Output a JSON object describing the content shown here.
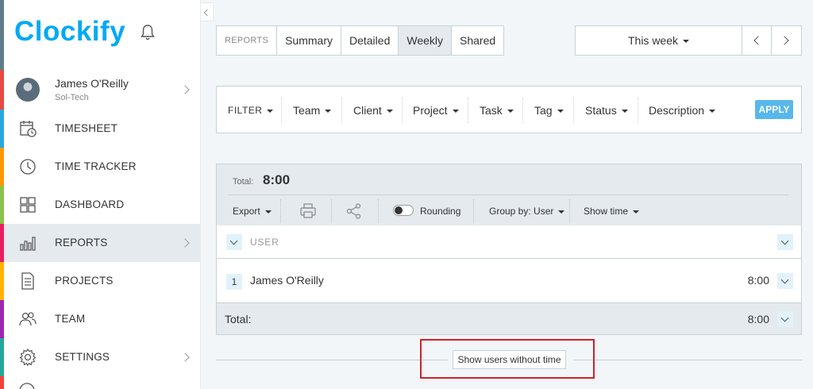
{
  "app": {
    "logo_text": "Clockify"
  },
  "user": {
    "name": "James O'Reilly",
    "workspace": "Sol-Tech"
  },
  "sidebar": {
    "items": [
      {
        "label": "TIMESHEET"
      },
      {
        "label": "TIME TRACKER"
      },
      {
        "label": "DASHBOARD"
      },
      {
        "label": "REPORTS",
        "active": true
      },
      {
        "label": "PROJECTS"
      },
      {
        "label": "TEAM"
      },
      {
        "label": "SETTINGS"
      }
    ],
    "stripe_colors": [
      "#e64a44",
      "#29a8e0",
      "#ff9800",
      "#8bc34a",
      "#e91e63",
      "#ffb300",
      "#9c27b0",
      "#26a69a",
      "#f44336"
    ]
  },
  "report_tabs": {
    "label": "REPORTS",
    "tabs": [
      "Summary",
      "Detailed",
      "Weekly",
      "Shared"
    ],
    "active": "Weekly"
  },
  "date_range": {
    "label": "This week"
  },
  "filters": {
    "items": [
      "FILTER",
      "Team",
      "Client",
      "Project",
      "Task",
      "Tag",
      "Status",
      "Description"
    ],
    "apply_label": "APPLY"
  },
  "report": {
    "total_label": "Total:",
    "total_value": "8:00",
    "toolbar": {
      "export": "Export",
      "rounding": "Rounding",
      "group_by": "Group by: User",
      "show_time": "Show time"
    },
    "table": {
      "header": "USER",
      "rows": [
        {
          "index": "1",
          "name": "James O'Reilly",
          "time": "8:00"
        }
      ],
      "footer_label": "Total:",
      "footer_time": "8:00"
    },
    "show_users_label": "Show users without time"
  },
  "colors": {
    "accent": "#03a9f4",
    "apply_button": "#58b8eb",
    "highlight": "#d0202a"
  }
}
